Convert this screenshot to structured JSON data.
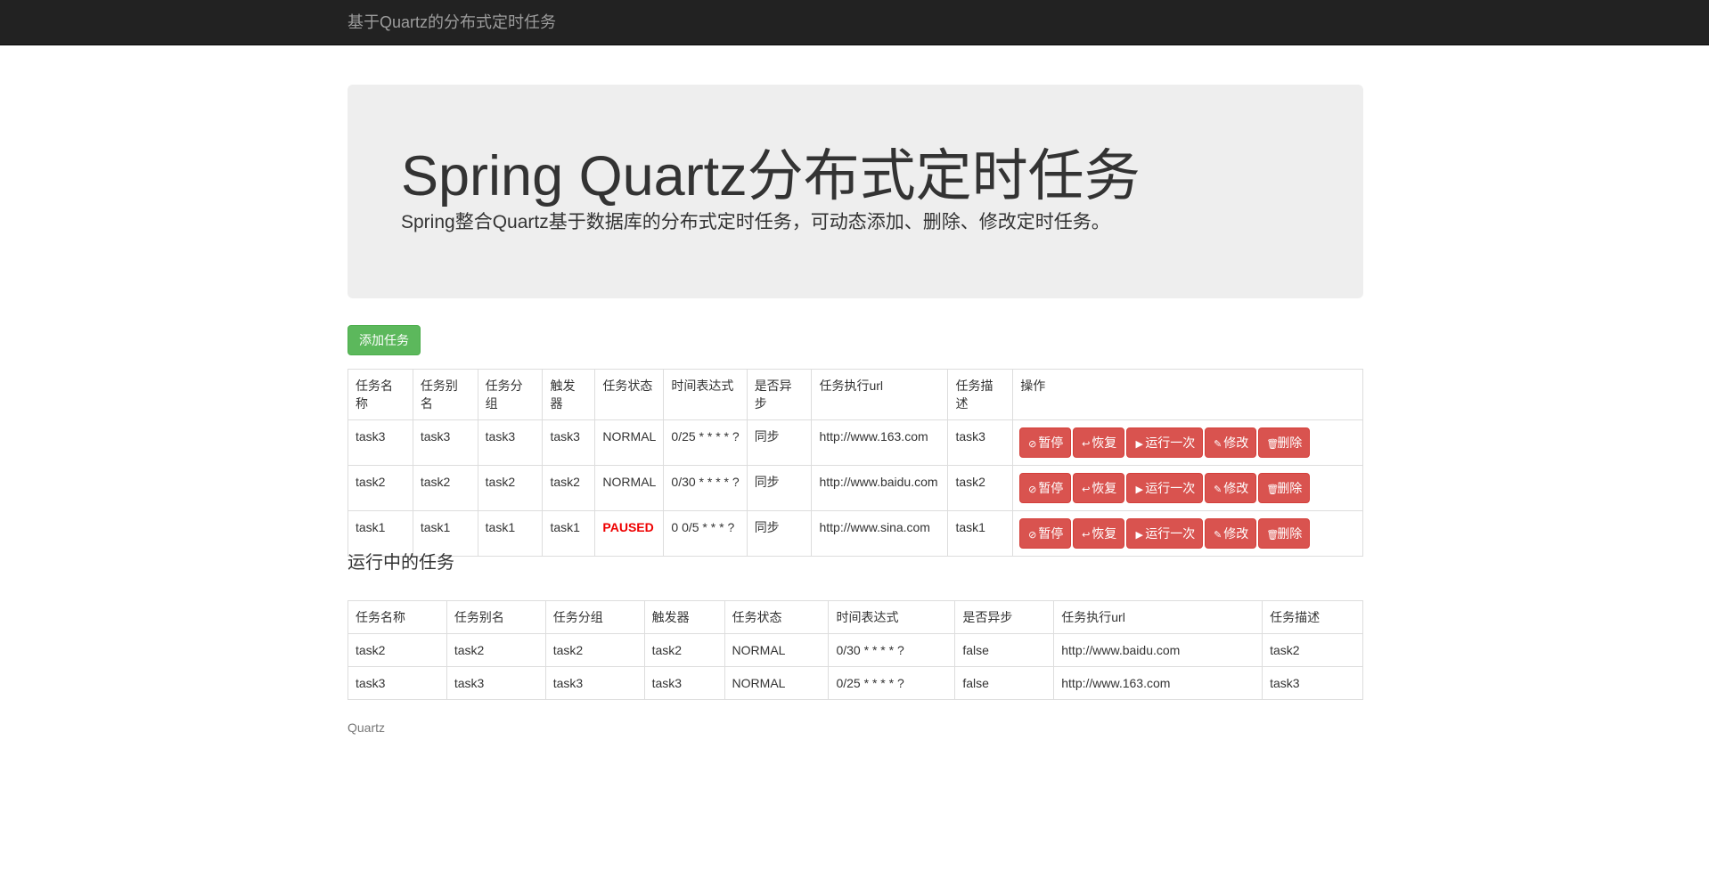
{
  "navbar": {
    "brand": "基于Quartz的分布式定时任务"
  },
  "jumbotron": {
    "title": "Spring Quartz分布式定时任务",
    "subtitle": "Spring整合Quartz基于数据库的分布式定时任务，可动态添加、删除、修改定时任务。"
  },
  "add_button": "添加任务",
  "task_table": {
    "headers": [
      "任务名称",
      "任务别名",
      "任务分组",
      "触发器",
      "任务状态",
      "时间表达式",
      "是否异步",
      "任务执行url",
      "任务描述",
      "操作"
    ],
    "rows": [
      {
        "name": "task3",
        "alias": "task3",
        "group": "task3",
        "trigger": "task3",
        "status": "NORMAL",
        "cron": "0/25 * * * * ?",
        "async": "同步",
        "url": "http://www.163.com",
        "desc": "task3"
      },
      {
        "name": "task2",
        "alias": "task2",
        "group": "task2",
        "trigger": "task2",
        "status": "NORMAL",
        "cron": "0/30 * * * * ?",
        "async": "同步",
        "url": "http://www.baidu.com",
        "desc": "task2"
      },
      {
        "name": "task1",
        "alias": "task1",
        "group": "task1",
        "trigger": "task1",
        "status": "PAUSED",
        "cron": "0 0/5 * * * ?",
        "async": "同步",
        "url": "http://www.sina.com",
        "desc": "task1"
      }
    ],
    "actions": [
      {
        "label": "暂停",
        "icon": "ban-circle-icon",
        "glyph": "⊘"
      },
      {
        "label": "恢复",
        "icon": "share-alt-icon",
        "glyph": "↩"
      },
      {
        "label": "运行一次",
        "icon": "play-icon",
        "glyph": "▶"
      },
      {
        "label": "修改",
        "icon": "pencil-icon",
        "glyph": "✎"
      },
      {
        "label": "删除",
        "icon": "trash-icon",
        "glyph": "🗑"
      }
    ]
  },
  "running_section_title": "运行中的任务",
  "running_table": {
    "headers": [
      "任务名称",
      "任务别名",
      "任务分组",
      "触发器",
      "任务状态",
      "时间表达式",
      "是否异步",
      "任务执行url",
      "任务描述"
    ],
    "rows": [
      {
        "name": "task2",
        "alias": "task2",
        "group": "task2",
        "trigger": "task2",
        "status": "NORMAL",
        "cron": "0/30 * * * * ?",
        "async": "false",
        "url": "http://www.baidu.com",
        "desc": "task2"
      },
      {
        "name": "task3",
        "alias": "task3",
        "group": "task3",
        "trigger": "task3",
        "status": "NORMAL",
        "cron": "0/25 * * * * ?",
        "async": "false",
        "url": "http://www.163.com",
        "desc": "task3"
      }
    ]
  },
  "footer": "Quartz",
  "colors": {
    "navbar_bg": "#222222",
    "jumbotron_bg": "#eeeeee",
    "success": "#5cb85c",
    "danger": "#d9534f",
    "paused_text": "#ee0000"
  }
}
